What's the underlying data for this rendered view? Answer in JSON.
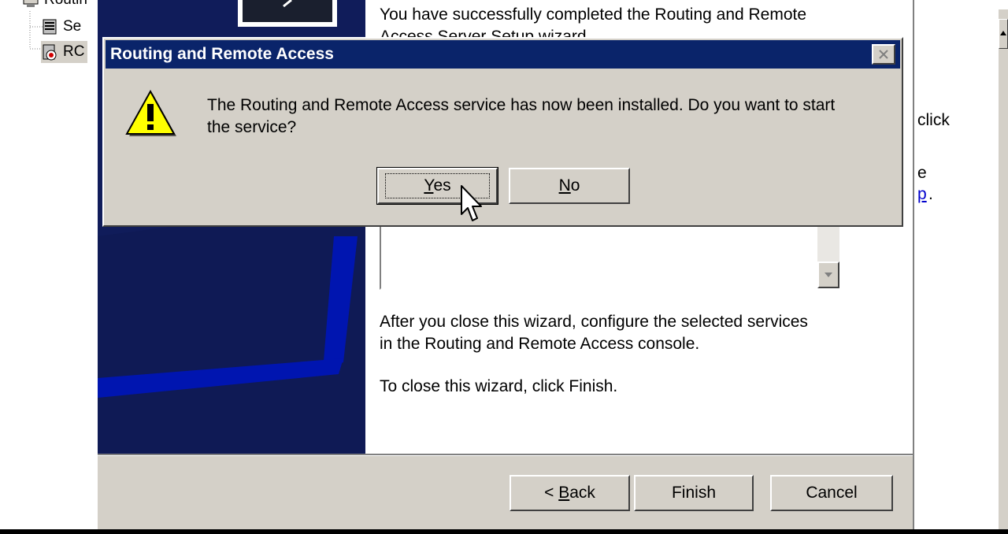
{
  "mmc": {
    "tree_items": [
      {
        "label": "Routin"
      },
      {
        "label": "Se"
      },
      {
        "label": "RC"
      }
    ],
    "right_fragments": {
      "click": "click",
      "e": "e",
      "p": "p",
      "period": "."
    }
  },
  "wizard": {
    "completed_text": "You have successfully completed the Routing and Remote",
    "completed_text_line2": "Access Server Setup wizard.",
    "after_close_line1": "After you close this wizard, configure the selected services",
    "after_close_line2": "in the Routing and  Remote Access console.",
    "finish_instruction": "To close this wizard, click Finish.",
    "buttons": {
      "back_prefix": "< ",
      "back_key": "B",
      "back_rest": "ack",
      "finish": "Finish",
      "cancel": "Cancel"
    }
  },
  "dialog": {
    "title": "Routing and Remote Access",
    "message_line1": "The Routing and Remote Access service has now been installed.  Do you want to start",
    "message_line2": "the service?",
    "yes_key": "Y",
    "yes_rest": "es",
    "no_key": "N",
    "no_rest": "o"
  },
  "colors": {
    "title_bar": "#0a246a",
    "face": "#d4d0c8",
    "banner": "#101c5a",
    "link": "#0000cc"
  },
  "icons": {
    "dialog": "warning-icon",
    "close": "close-icon",
    "cursor": "arrow-cursor-icon"
  }
}
